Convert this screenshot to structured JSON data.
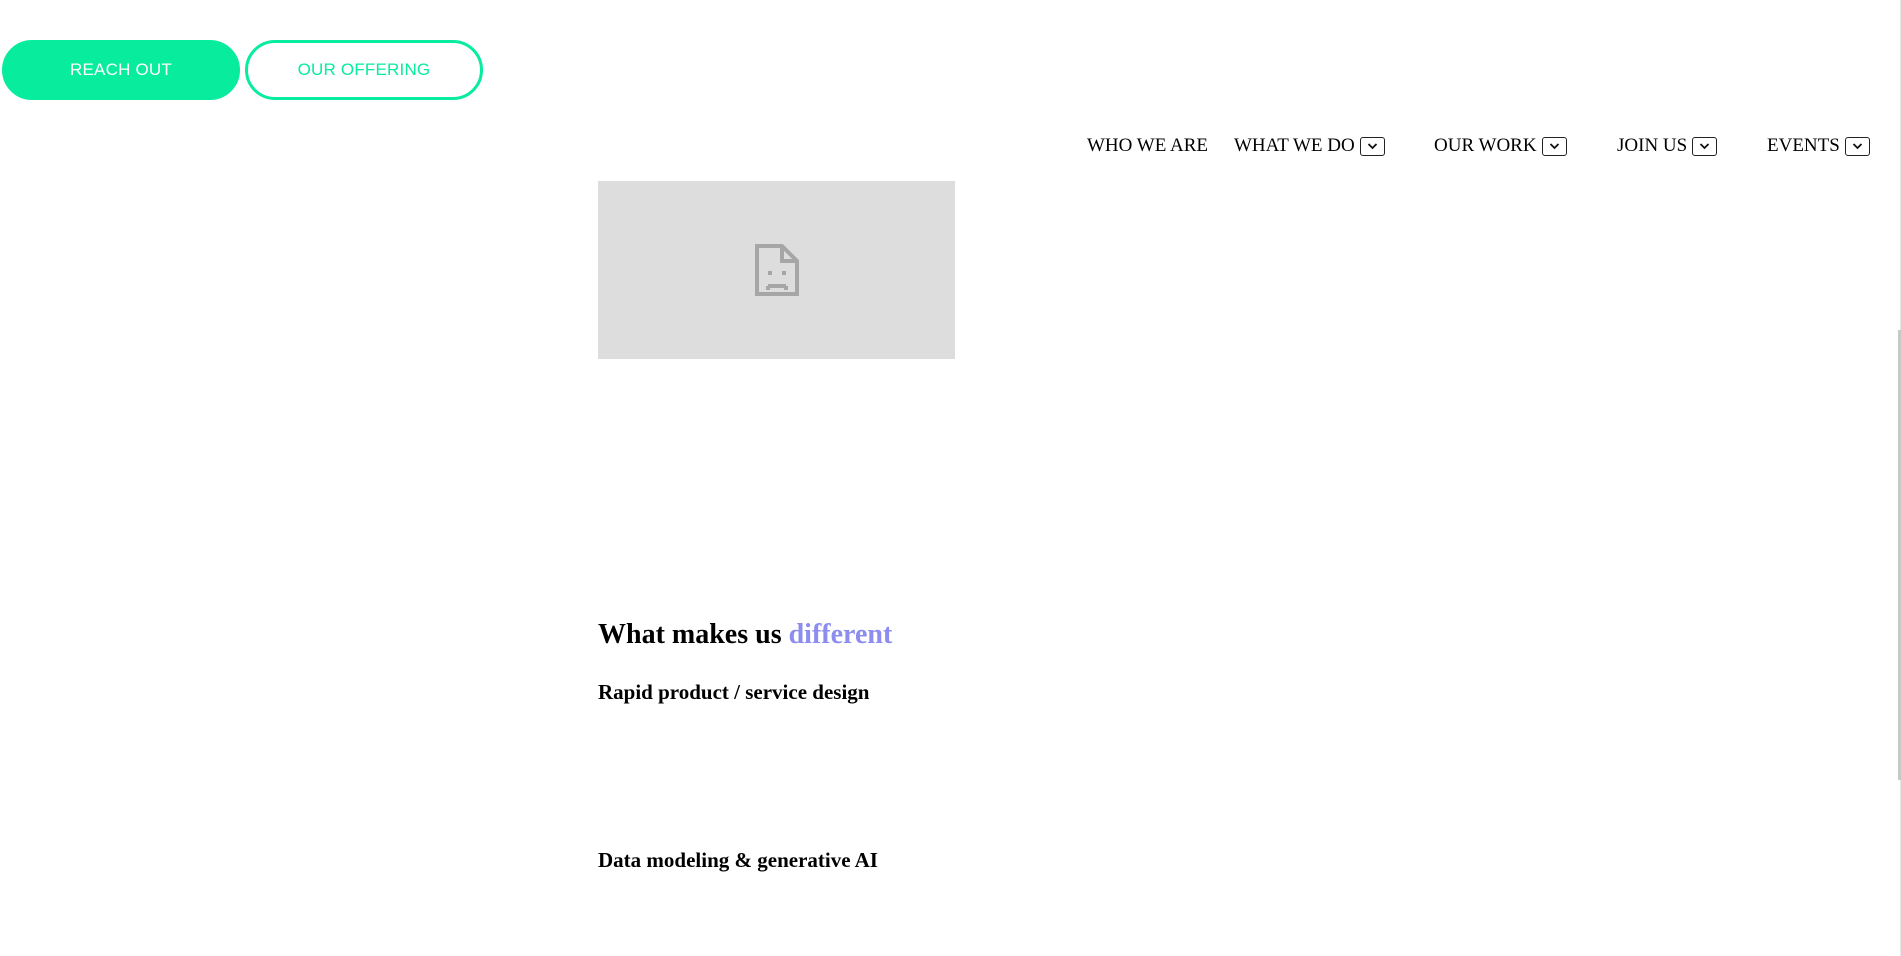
{
  "cta": {
    "primary_label": "REACH OUT",
    "secondary_label": "OUR OFFERING",
    "accent_color": "#07ec9d"
  },
  "nav": {
    "items": [
      {
        "label": "WHO WE ARE"
      },
      {
        "label": "WHAT WE DO"
      },
      {
        "label": "OUR WORK"
      },
      {
        "label": "JOIN US"
      },
      {
        "label": "EVENTS"
      }
    ],
    "dropdown_icon": "chevron-down-icon"
  },
  "hero_image": {
    "icon": "broken-image-icon"
  },
  "section": {
    "title_main": "What makes us ",
    "title_accent": "different",
    "accent_color": "#8d8cef"
  },
  "features": [
    {
      "title": "Rapid product / service design"
    },
    {
      "title": "Data modeling & generative AI"
    }
  ]
}
